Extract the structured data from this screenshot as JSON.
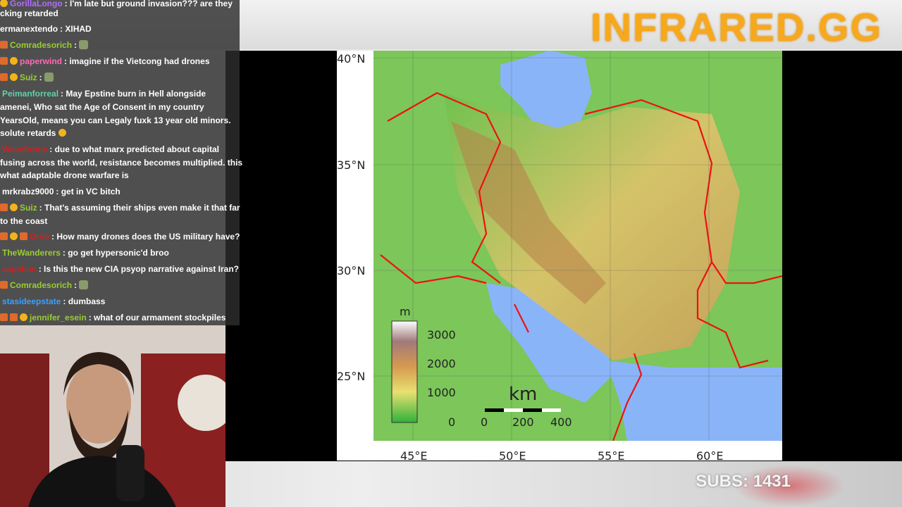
{
  "brand": "INFRARED.GG",
  "subs": "SUBS: 1431",
  "map": {
    "lat_labels": [
      "40°N",
      "35°N",
      "30°N",
      "25°N"
    ],
    "lon_labels": [
      "45°E",
      "50°E",
      "55°E",
      "60°E"
    ],
    "legend_unit": "m",
    "legend_ticks": [
      "3000",
      "2000",
      "1000",
      "0"
    ],
    "scale_unit": "km",
    "scale_ticks": [
      "0",
      "200",
      "400"
    ]
  },
  "chat": [
    {
      "user": "GorillaLongo",
      "text": ": I'm late but ground invasion??? are they",
      "color": "#b36bff"
    },
    {
      "user": "",
      "text": "cking retarded",
      "color": "#ffffff"
    },
    {
      "user": "ermanextendo",
      "text": ": XIHAD",
      "color": "#ffffff"
    },
    {
      "user": "Comradesorich",
      "text": ":",
      "color": "#9acd32"
    },
    {
      "user": "paperwind",
      "text": ": imagine if the Vietcong had drones",
      "color": "#ff69b4"
    },
    {
      "user": "Suiz",
      "text": ":",
      "color": "#9acd32"
    },
    {
      "user": "Peimanforreal",
      "text": ": May Epstine burn in Hell alongside",
      "color": "#5fd3a8"
    },
    {
      "user": "",
      "text": "amenei, Who sat the Age of Consent in my country",
      "color": "#ffffff"
    },
    {
      "user": "",
      "text": "YearsOld, means you can Legaly fuxk 13 year old minors.",
      "color": "#ffffff"
    },
    {
      "user": "",
      "text": "solute retards",
      "color": "#ffffff"
    },
    {
      "user": "Waveforms",
      "text": ": due to what marx predicted about capital",
      "color": "#d02020"
    },
    {
      "user": "",
      "text": "fusing across the world, resistance becomes multiplied. this",
      "color": "#ffffff"
    },
    {
      "user": "",
      "text": "what adaptable drone warfare is",
      "color": "#ffffff"
    },
    {
      "user": "mrkrabz9000",
      "text": ": get in VC bitch",
      "color": "#ffffff"
    },
    {
      "user": "Suiz",
      "text": ": That's assuming their ships even make it that far",
      "color": "#9acd32"
    },
    {
      "user": "",
      "text": "to the coast",
      "color": "#ffffff"
    },
    {
      "user": "Orvo",
      "text": ": How many drones does the US military have?",
      "color": "#d02020"
    },
    {
      "user": "TheWanderers",
      "text": ": go get hypersonic'd broo",
      "color": "#9acd32"
    },
    {
      "user": "acpchan",
      "text": ": Is this the new CIA psyop narrative against Iran?",
      "color": "#d02020"
    },
    {
      "user": "Comradesorich",
      "text": ":",
      "color": "#9acd32"
    },
    {
      "user": "stasideepstate",
      "text": ": dumbass",
      "color": "#3aa0ff"
    },
    {
      "user": "jennifer_esein",
      "text": ": what of our armament stockpiles",
      "color": "#9acd32"
    }
  ]
}
